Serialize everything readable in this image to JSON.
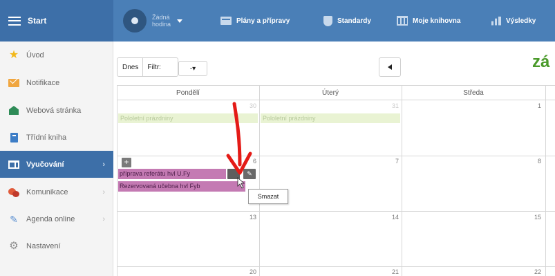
{
  "topbar": {
    "start_label": "Start",
    "hour_label": "Žádná hodina",
    "nav": [
      {
        "label": "Plány a přípravy",
        "icon": "plans-icon"
      },
      {
        "label": "Standardy",
        "icon": "shield-icon"
      },
      {
        "label": "Moje knihovna",
        "icon": "library-icon"
      },
      {
        "label": "Výsledky",
        "icon": "results-icon"
      }
    ]
  },
  "sidebar": {
    "items": [
      {
        "label": "Úvod",
        "icon": "star-icon"
      },
      {
        "label": "Notifikace",
        "icon": "envelope-icon"
      },
      {
        "label": "Webová stránka",
        "icon": "house-icon"
      },
      {
        "label": "Třídní kniha",
        "icon": "book-icon"
      },
      {
        "label": "Vyučování",
        "icon": "open-book-icon",
        "active": true
      },
      {
        "label": "Komunikace",
        "icon": "chat-bubbles-icon"
      },
      {
        "label": "Agenda online",
        "icon": "pen-icon"
      },
      {
        "label": "Nastavení",
        "icon": "gear-icon"
      }
    ],
    "chevron": "›"
  },
  "toolbar": {
    "today_label": "Dnes",
    "filter_label": "Filtr:",
    "filter_value": "-▾",
    "month_title": "zá"
  },
  "calendar": {
    "days": [
      "Pondělí",
      "Úterý",
      "Středa"
    ],
    "week1": {
      "mon": "30",
      "tue": "31",
      "wed": "1"
    },
    "week2": {
      "mon": "6",
      "tue": "7",
      "wed": "8"
    },
    "week3": {
      "mon": "13",
      "tue": "14",
      "wed": "15"
    },
    "week4": {
      "mon": "20",
      "tue": "21",
      "wed": "22"
    },
    "holiday_label": "Pololetní prázdniny",
    "events": [
      "příprava referátu hvl U.Fy",
      "Rezervovaná učebna hvl Fyb"
    ],
    "add_label": "+",
    "edit_label": "✎",
    "tooltip": "Smazat"
  },
  "colors": {
    "topbar": "#4a7fb7",
    "active_sidebar": "#3d6fa8",
    "event": "#c47ab3",
    "holiday": "#e9f3d3",
    "month_title": "#4a9a2a",
    "annotation_arrow": "#e41b17"
  }
}
